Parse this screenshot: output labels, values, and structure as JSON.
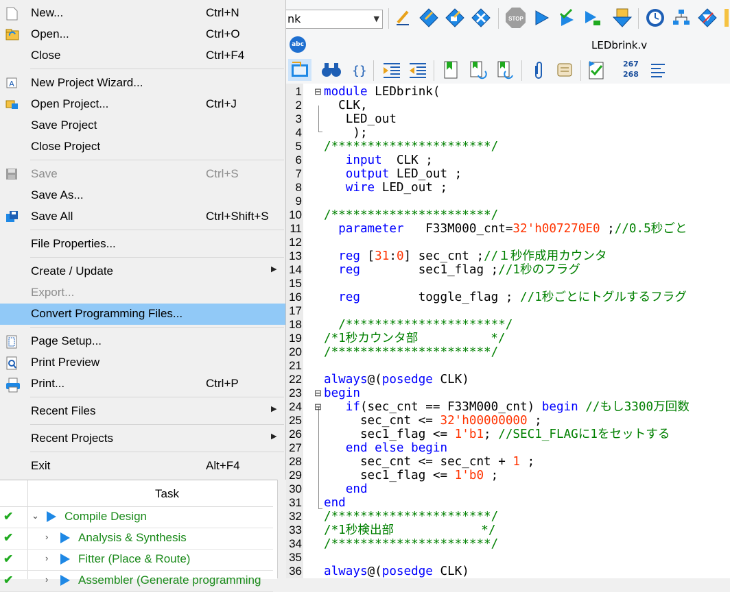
{
  "toolbar": {
    "combo_value": "nk",
    "icons": [
      "pen-icon",
      "pen-doc-icon",
      "pen-chip-icon",
      "cross-diamond-icon",
      "stop-icon",
      "play-icon",
      "check-play-icon",
      "play-chip-icon",
      "download-icon",
      "timer-icon",
      "hierarchy-icon",
      "blue-chevron-icon"
    ]
  },
  "tabs": {
    "file_tab": "LEDbrink.v"
  },
  "toolbar2": {
    "line_numbers_top": "267",
    "line_numbers_bottom": "268"
  },
  "menu": {
    "items": [
      {
        "label": "New...",
        "shortcut": "Ctrl+N",
        "icon": "new-file-icon"
      },
      {
        "label": "Open...",
        "shortcut": "Ctrl+O",
        "icon": "open-folder-icon"
      },
      {
        "label": "Close",
        "shortcut": "Ctrl+F4"
      },
      {
        "label": "New Project Wizard...",
        "icon": "wizard-icon"
      },
      {
        "label": "Open Project...",
        "shortcut": "Ctrl+J",
        "icon": "open-project-icon"
      },
      {
        "label": "Save Project"
      },
      {
        "label": "Close Project"
      },
      {
        "label": "Save",
        "shortcut": "Ctrl+S",
        "icon": "save-icon",
        "disabled": true
      },
      {
        "label": "Save As..."
      },
      {
        "label": "Save All",
        "shortcut": "Ctrl+Shift+S",
        "icon": "save-all-icon"
      },
      {
        "label": "File Properties..."
      },
      {
        "label": "Create / Update",
        "submenu": true
      },
      {
        "label": "Export...",
        "disabled": true
      },
      {
        "label": "Convert Programming Files...",
        "highlighted": true
      },
      {
        "label": "Page Setup...",
        "icon": "page-setup-icon"
      },
      {
        "label": "Print Preview",
        "icon": "print-preview-icon"
      },
      {
        "label": "Print...",
        "shortcut": "Ctrl+P",
        "icon": "printer-icon"
      },
      {
        "label": "Recent Files",
        "submenu": true
      },
      {
        "label": "Recent Projects",
        "submenu": true
      },
      {
        "label": "Exit",
        "shortcut": "Alt+F4"
      }
    ]
  },
  "tasks": {
    "header": "Task",
    "rows": [
      {
        "label": "Compile Design",
        "status": "done",
        "expander": "⌄"
      },
      {
        "label": "Analysis & Synthesis",
        "status": "done",
        "expander": "›"
      },
      {
        "label": "Fitter (Place & Route)",
        "status": "done",
        "expander": "›"
      },
      {
        "label": "Assembler (Generate programming",
        "status": "done",
        "expander": "›"
      }
    ]
  },
  "code": {
    "lines": [
      {
        "n": "1",
        "fold": "⊟",
        "t": "module LEDbrink("
      },
      {
        "n": "2",
        "t": "  CLK,"
      },
      {
        "n": "3",
        "t": "   LED_out"
      },
      {
        "n": "4",
        "t": "    );"
      },
      {
        "n": "5",
        "t": "/**********************/"
      },
      {
        "n": "6",
        "t": "   input  CLK ;"
      },
      {
        "n": "7",
        "t": "   output LED_out ;"
      },
      {
        "n": "8",
        "t": "   wire LED_out ;"
      },
      {
        "n": "9",
        "t": ""
      },
      {
        "n": "10",
        "t": "/**********************/"
      },
      {
        "n": "11",
        "t": "  parameter   F33M000_cnt=32'h007270E0 ;//0.5秒ごと"
      },
      {
        "n": "12",
        "t": ""
      },
      {
        "n": "13",
        "t": "  reg [31:0] sec_cnt ;//１秒作成用カウンタ"
      },
      {
        "n": "14",
        "t": "  reg        sec1_flag ;//1秒のフラグ"
      },
      {
        "n": "15",
        "t": ""
      },
      {
        "n": "16",
        "t": "  reg        toggle_flag ; //1秒ごとにトグルするフラグ"
      },
      {
        "n": "17",
        "t": ""
      },
      {
        "n": "18",
        "t": "  /**********************/"
      },
      {
        "n": "19",
        "t": "/*1秒カウンタ部          */"
      },
      {
        "n": "20",
        "t": "/**********************/"
      },
      {
        "n": "21",
        "t": ""
      },
      {
        "n": "22",
        "t": "always@(posedge CLK)"
      },
      {
        "n": "23",
        "fold": "⊟",
        "t": "begin"
      },
      {
        "n": "24",
        "fold": "⊟",
        "t": "   if(sec_cnt == F33M000_cnt) begin //もし3300万回数"
      },
      {
        "n": "25",
        "t": "     sec_cnt <= 32'h00000000 ;"
      },
      {
        "n": "26",
        "t": "     sec1_flag <= 1'b1; //SEC1_FLAGに1をセットする"
      },
      {
        "n": "27",
        "t": "   end else begin"
      },
      {
        "n": "28",
        "t": "     sec_cnt <= sec_cnt + 1 ;"
      },
      {
        "n": "29",
        "t": "     sec1_flag <= 1'b0 ;"
      },
      {
        "n": "30",
        "t": "   end"
      },
      {
        "n": "31",
        "t": "end"
      },
      {
        "n": "32",
        "t": "/**********************/"
      },
      {
        "n": "33",
        "t": "/*1秒検出部            */"
      },
      {
        "n": "34",
        "t": "/**********************/"
      },
      {
        "n": "35",
        "t": ""
      },
      {
        "n": "36",
        "t": "always@(posedge CLK)"
      }
    ]
  },
  "colors": {
    "keyword": "#0000ff",
    "comment": "#008000",
    "number": "#ff3300",
    "highlight": "#91c9f7",
    "check": "#1faa1f"
  }
}
